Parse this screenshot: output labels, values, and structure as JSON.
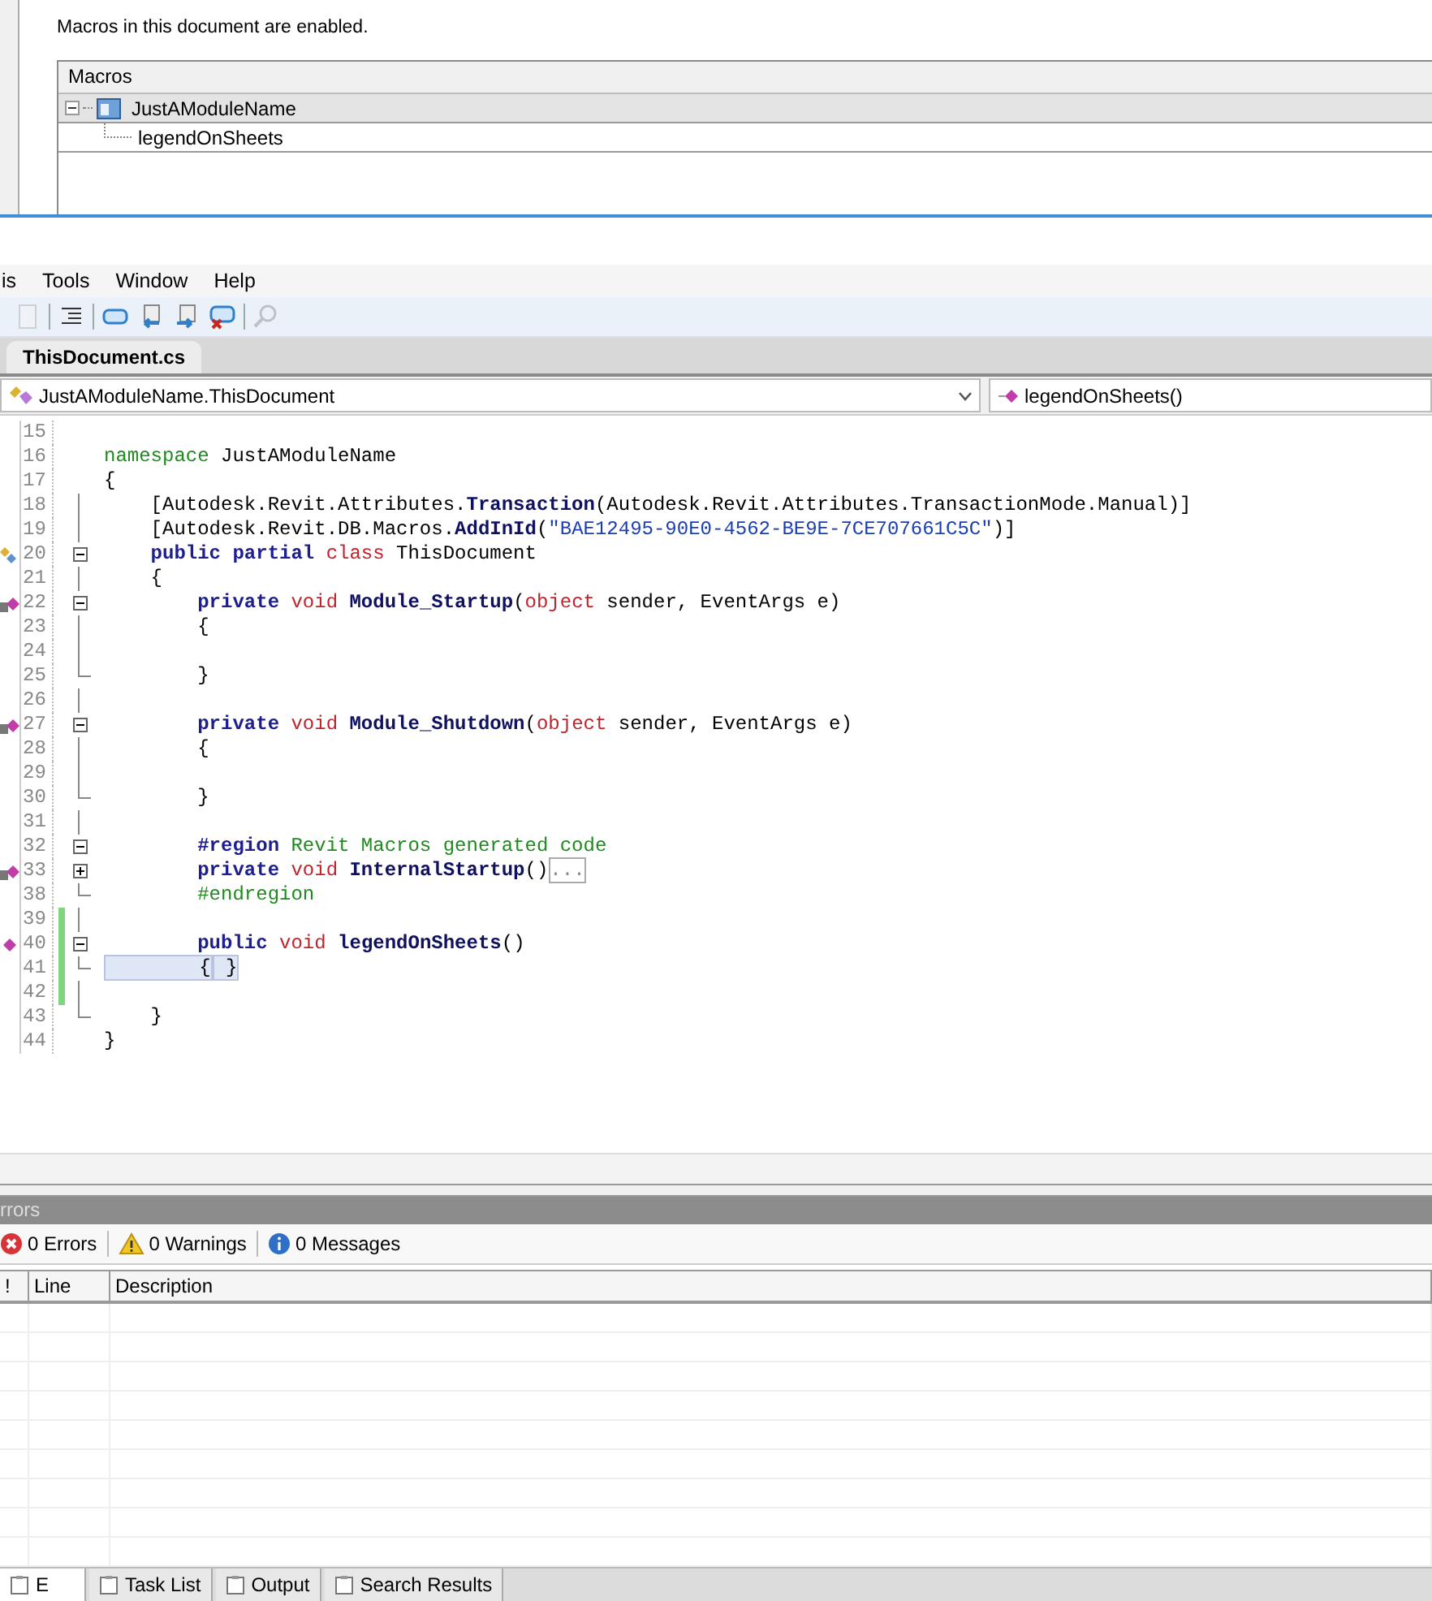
{
  "macros_dialog": {
    "status": "Macros in this document are enabled.",
    "tree": {
      "header": "Macros",
      "items": [
        {
          "label": "JustAModuleName",
          "selected": true,
          "expanded": true,
          "children": [
            {
              "label": "legendOnSheets",
              "selected": false
            }
          ]
        }
      ]
    }
  },
  "menu_bar": [
    "is",
    "Tools",
    "Window",
    "Help"
  ],
  "toolbar": [
    {
      "kind": "doc",
      "disabled": true
    },
    {
      "kind": "sep"
    },
    {
      "kind": "indent",
      "disabled": false
    },
    {
      "kind": "sep"
    },
    {
      "kind": "comment",
      "disabled": false
    },
    {
      "kind": "bookmark-prev",
      "disabled": false
    },
    {
      "kind": "bookmark-next",
      "disabled": false
    },
    {
      "kind": "bookmark-clear",
      "disabled": false
    },
    {
      "kind": "sep"
    },
    {
      "kind": "find",
      "disabled": true
    }
  ],
  "tabs": [
    {
      "label": "ThisDocument.cs",
      "selected": true
    }
  ],
  "navigation": {
    "type_combo": "JustAModuleName.ThisDocument",
    "member_combo": "legendOnSheets()"
  },
  "code_lines": [
    {
      "number": "15",
      "kind": "plain",
      "changed": false
    },
    {
      "number": "16",
      "kind": "plain",
      "changed": false,
      "tokens": [
        {
          "kind": "ns",
          "text": "namespace"
        },
        {
          "kind": "plain",
          "text": " JustAModuleName"
        }
      ]
    },
    {
      "number": "17",
      "kind": "plain",
      "changed": false,
      "tokens": [
        {
          "kind": "plain",
          "text": "{"
        }
      ]
    },
    {
      "number": "18",
      "kind": "plain",
      "changed": false,
      "in_fold": true,
      "tokens": [
        {
          "kind": "plain",
          "text": "    [Autodesk.Revit.Attributes."
        },
        {
          "kind": "ident",
          "text": "Transaction"
        },
        {
          "kind": "plain",
          "text": "(Autodesk.Revit.Attributes.TransactionMode.Manual)]"
        }
      ]
    },
    {
      "number": "19",
      "kind": "plain",
      "changed": false,
      "in_fold": true,
      "tokens": [
        {
          "kind": "plain",
          "text": "    [Autodesk.Revit.DB.Macros."
        },
        {
          "kind": "ident",
          "text": "AddInId"
        },
        {
          "kind": "plain",
          "text": "("
        },
        {
          "kind": "str",
          "text": "\"BAE12495-90E0-4562-BE9E-7CE707661C5C\""
        },
        {
          "kind": "plain",
          "text": ")]"
        }
      ]
    },
    {
      "number": "20",
      "kind": "class",
      "changed": false,
      "fold_start": true,
      "expanded": true,
      "tokens": [
        {
          "kind": "kw",
          "text": "    public "
        },
        {
          "kind": "kw",
          "text": "partial "
        },
        {
          "kind": "type",
          "text": "class"
        },
        {
          "kind": "plain",
          "text": " ThisDocument"
        }
      ]
    },
    {
      "number": "21",
      "kind": "plain",
      "changed": false,
      "in_fold": true,
      "tokens": [
        {
          "kind": "plain",
          "text": "    {"
        }
      ]
    },
    {
      "number": "22",
      "kind": "method",
      "changed": false,
      "fold_start": true,
      "expanded": true,
      "tokens": [
        {
          "kind": "kw",
          "text": "        private "
        },
        {
          "kind": "type",
          "text": "void "
        },
        {
          "kind": "ident",
          "text": "Module_Startup"
        },
        {
          "kind": "plain",
          "text": "("
        },
        {
          "kind": "type",
          "text": "object"
        },
        {
          "kind": "plain",
          "text": " sender, EventArgs e)"
        }
      ]
    },
    {
      "number": "23",
      "kind": "plain",
      "changed": false,
      "in_fold": true,
      "tokens": [
        {
          "kind": "plain",
          "text": "        {"
        }
      ]
    },
    {
      "number": "24",
      "kind": "plain",
      "changed": false,
      "in_fold": true
    },
    {
      "number": "25",
      "kind": "plain",
      "changed": false,
      "fold_end": true,
      "tokens": [
        {
          "kind": "plain",
          "text": "        }"
        }
      ]
    },
    {
      "number": "26",
      "kind": "plain",
      "changed": false,
      "in_fold": true
    },
    {
      "number": "27",
      "kind": "method",
      "changed": false,
      "fold_start": true,
      "expanded": true,
      "tokens": [
        {
          "kind": "kw",
          "text": "        private "
        },
        {
          "kind": "type",
          "text": "void "
        },
        {
          "kind": "ident",
          "text": "Module_Shutdown"
        },
        {
          "kind": "plain",
          "text": "("
        },
        {
          "kind": "type",
          "text": "object"
        },
        {
          "kind": "plain",
          "text": " sender, EventArgs e)"
        }
      ]
    },
    {
      "number": "28",
      "kind": "plain",
      "changed": false,
      "in_fold": true,
      "tokens": [
        {
          "kind": "plain",
          "text": "        {"
        }
      ]
    },
    {
      "number": "29",
      "kind": "plain",
      "changed": false,
      "in_fold": true
    },
    {
      "number": "30",
      "kind": "plain",
      "changed": false,
      "fold_end": true,
      "tokens": [
        {
          "kind": "plain",
          "text": "        }"
        }
      ]
    },
    {
      "number": "31",
      "kind": "plain",
      "changed": false,
      "in_fold": true
    },
    {
      "number": "32",
      "kind": "plain",
      "changed": false,
      "fold_start": true,
      "expanded": true,
      "tokens": [
        {
          "kind": "kw",
          "text": "        #region "
        },
        {
          "kind": "ns",
          "text": "Revit Macros generated code"
        }
      ]
    },
    {
      "number": "33",
      "kind": "method",
      "changed": false,
      "fold_start": true,
      "expanded": false,
      "tokens": [
        {
          "kind": "kw",
          "text": "        private "
        },
        {
          "kind": "type",
          "text": "void "
        },
        {
          "kind": "ident",
          "text": "InternalStartup"
        },
        {
          "kind": "plain",
          "text": "()"
        },
        {
          "kind": "collapsed",
          "text": "..."
        }
      ]
    },
    {
      "number": "38",
      "kind": "plain",
      "changed": false,
      "fold_end": true,
      "tokens": [
        {
          "kind": "ns",
          "text": "        #endregion"
        }
      ]
    },
    {
      "number": "39",
      "kind": "plain",
      "changed": true,
      "in_fold": true
    },
    {
      "number": "40",
      "kind": "member",
      "changed": true,
      "fold_start": true,
      "expanded": true,
      "tokens": [
        {
          "kind": "kw",
          "text": "        public "
        },
        {
          "kind": "type",
          "text": "void "
        },
        {
          "kind": "ident",
          "text": "legendOnSheets"
        },
        {
          "kind": "plain",
          "text": "()"
        }
      ]
    },
    {
      "number": "41",
      "kind": "plain",
      "changed": true,
      "fold_end": true,
      "tokens": [
        {
          "kind": "brace",
          "text": "        {"
        },
        {
          "kind": "brace",
          "text": " }"
        }
      ]
    },
    {
      "number": "42",
      "kind": "plain",
      "changed": true,
      "in_fold": true
    },
    {
      "number": "43",
      "kind": "plain",
      "changed": false,
      "fold_end": true,
      "tokens": [
        {
          "kind": "plain",
          "text": "    }"
        }
      ]
    },
    {
      "number": "44",
      "kind": "plain",
      "changed": false,
      "tokens": [
        {
          "kind": "plain",
          "text": "}"
        }
      ]
    }
  ],
  "errors_panel": {
    "title": "rrors",
    "filters": [
      {
        "kind": "error",
        "label": "0 Errors"
      },
      {
        "kind": "warning",
        "label": "0 Warnings"
      },
      {
        "kind": "info",
        "label": "0 Messages"
      }
    ],
    "columns": [
      "!",
      "Line",
      "Description"
    ]
  },
  "bottom_tabs": [
    {
      "label": "E",
      "selected": true
    },
    {
      "label": "Task List",
      "selected": false
    },
    {
      "label": "Output",
      "selected": false
    },
    {
      "label": "Search Results",
      "selected": false
    }
  ]
}
